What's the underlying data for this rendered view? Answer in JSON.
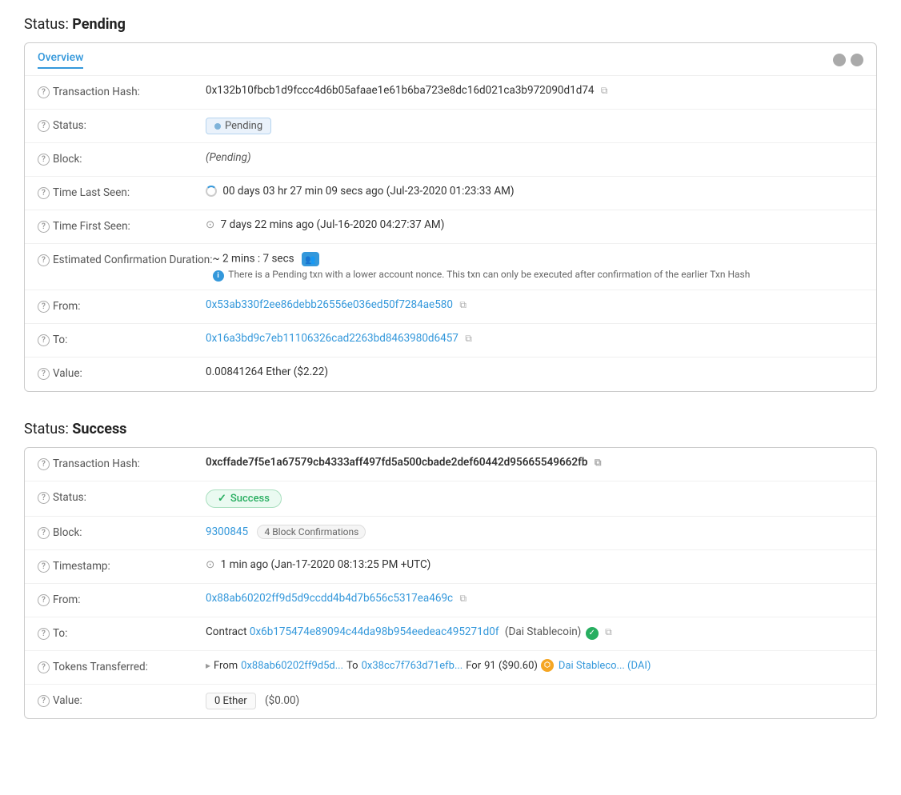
{
  "pending_section": {
    "title": "Status:",
    "title_bold": "Pending",
    "card": {
      "tab_label": "Overview",
      "rows": {
        "tx_hash_label": "Transaction Hash:",
        "tx_hash_value": "0x132b10fbcb1d9fccc4d6b05afaae1e61b6ba723e8dc16d021ca3b972090d1d74",
        "status_label": "Status:",
        "status_value": "Pending",
        "block_label": "Block:",
        "block_value": "(Pending)",
        "time_last_seen_label": "Time Last Seen:",
        "time_last_seen_value": "00 days 03 hr 27 min 09 secs ago (Jul-23-2020 01:23:33 AM)",
        "time_first_seen_label": "Time First Seen:",
        "time_first_seen_value": "7 days 22 mins ago (Jul-16-2020 04:27:37 AM)",
        "est_confirm_label": "Estimated Confirmation Duration:",
        "est_confirm_value": "~ 2 mins : 7 secs",
        "est_confirm_note": "There is a Pending txn with a lower account nonce. This txn can only be executed after confirmation of the earlier Txn Hash",
        "from_label": "From:",
        "from_value": "0x53ab330f2ee86debb26556e036ed50f7284ae580",
        "to_label": "To:",
        "to_value": "0x16a3bd9c7eb11106326cad2263bd8463980d6457",
        "value_label": "Value:",
        "value_value": "0.00841264 Ether ($2.22)"
      }
    }
  },
  "success_section": {
    "title": "Status:",
    "title_bold": "Success",
    "card": {
      "rows": {
        "tx_hash_label": "Transaction Hash:",
        "tx_hash_value": "0xcffade7f5e1a67579cb4333aff497fd5a500cbade2def60442d95665549662fb",
        "status_label": "Status:",
        "status_value": "Success",
        "block_label": "Block:",
        "block_value": "9300845",
        "block_confirmations": "4 Block Confirmations",
        "timestamp_label": "Timestamp:",
        "timestamp_value": "1 min ago (Jan-17-2020 08:13:25 PM +UTC)",
        "from_label": "From:",
        "from_value": "0x88ab60202ff9d5d9ccdd4b4d7b656c5317ea469c",
        "to_label": "To:",
        "to_contract_prefix": "Contract",
        "to_contract_address": "0x6b175474e89094c44da98b954eedeac495271d0f",
        "to_contract_name": "(Dai Stablecoin)",
        "tokens_transferred_label": "Tokens Transferred:",
        "tokens_from_label": "From",
        "tokens_from_value": "0x88ab60202ff9d5d...",
        "tokens_to_label": "To",
        "tokens_to_value": "0x38cc7f763d71efb...",
        "tokens_for_label": "For",
        "tokens_amount": "91 ($90.60)",
        "tokens_name": "Dai Stableco... (DAI)",
        "value_label": "Value:",
        "value_eth": "0 Ether",
        "value_usd": "($0.00)"
      }
    }
  },
  "icons": {
    "question": "?",
    "copy": "⧉",
    "clock": "⊙",
    "spinner": "↻",
    "arrow": "▸",
    "checkmark": "✓",
    "info": "i"
  }
}
